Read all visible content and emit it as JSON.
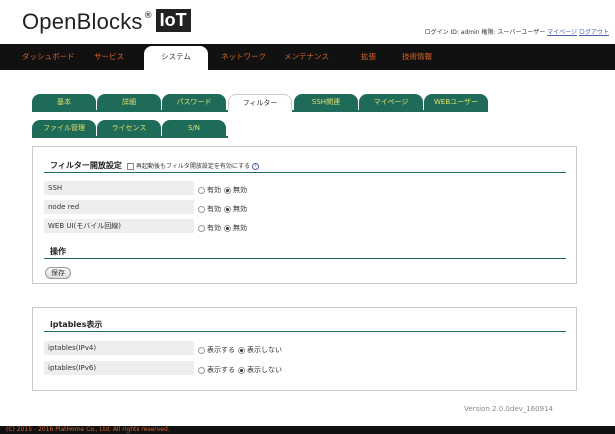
{
  "header": {
    "brand": "OpenBlocks",
    "brand_reg": "®",
    "brand_suffix": "IoT",
    "login_text": "ログイン ID: admin 権限: スーパーユーザー",
    "mypage_link": "マイページ",
    "logout_link": "ログアウト"
  },
  "topnav": {
    "items": [
      "ダッシュボード",
      "サービス",
      "システム",
      "ネットワーク",
      "メンテナンス",
      "拡張",
      "技術情報"
    ],
    "active_index": 2
  },
  "tabs": {
    "row1": [
      "基本",
      "詳細",
      "パスワード",
      "フィルター",
      "SSH関連",
      "マイページ",
      "WEBユーザー"
    ],
    "row2": [
      "ファイル管理",
      "ライセンス",
      "S/N"
    ],
    "selected": "フィルター"
  },
  "filter_section": {
    "title": "フィルター開放設定",
    "checkbox_label": "再起動後もフィルタ開放設定を有効にする",
    "help": "?",
    "rows": [
      {
        "label": "SSH",
        "enabled": false
      },
      {
        "label": "node red",
        "enabled": false
      },
      {
        "label": "WEB UI(モバイル回線)",
        "enabled": false
      }
    ],
    "enable_label": "有効",
    "disable_label": "無効"
  },
  "operation": {
    "title": "操作",
    "save_button": "保存"
  },
  "iptables_section": {
    "title": "iptables表示",
    "rows": [
      {
        "label": "iptables(IPv4)",
        "show": false
      },
      {
        "label": "iptables(IPv6)",
        "show": false
      }
    ],
    "show_label": "表示する",
    "hide_label": "表示しない"
  },
  "version": "Version 2.0.0dev_160914",
  "footer": "(C) 2015 - 2016 PlatHome Co., Ltd. All rights reserved.",
  "colors": {
    "tab_bg": "#1f6b5a",
    "tab_text": "#e0e070",
    "nav_bg": "#111111",
    "nav_text": "#d9652b",
    "link": "#4a5bb0"
  }
}
